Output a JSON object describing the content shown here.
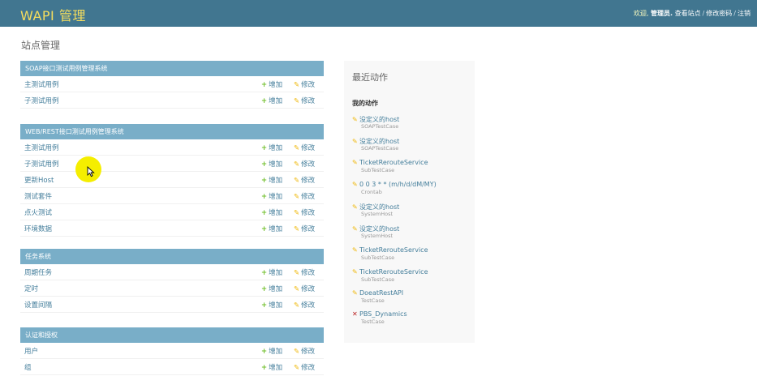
{
  "header": {
    "brand": "WAPI 管理",
    "welcome": "欢迎,",
    "username": "管理员.",
    "view_site": "查看站点",
    "change_password": "修改密码",
    "logout": "注销"
  },
  "page_title": "站点管理",
  "modules": [
    {
      "caption": "SOAP接口测试用例管理系统",
      "rows": [
        {
          "name": "主测试用例",
          "add": "增加",
          "change": "修改"
        },
        {
          "name": "子测试用例",
          "add": "增加",
          "change": "修改"
        }
      ]
    },
    {
      "caption": "WEB/REST接口测试用例管理系统",
      "rows": [
        {
          "name": "主测试用例",
          "add": "增加",
          "change": "修改"
        },
        {
          "name": "子测试用例",
          "add": "增加",
          "change": "修改"
        },
        {
          "name": "更新Host",
          "add": "增加",
          "change": "修改"
        },
        {
          "name": "测试套件",
          "add": "增加",
          "change": "修改"
        },
        {
          "name": "点火测试",
          "add": "增加",
          "change": "修改"
        },
        {
          "name": "环境数据",
          "add": "增加",
          "change": "修改"
        }
      ]
    },
    {
      "caption": "任务系统",
      "rows": [
        {
          "name": "周期任务",
          "add": "增加",
          "change": "修改"
        },
        {
          "name": "定时",
          "add": "增加",
          "change": "修改"
        },
        {
          "name": "设置间隔",
          "add": "增加",
          "change": "修改"
        }
      ]
    },
    {
      "caption": "认证和授权",
      "rows": [
        {
          "name": "用户",
          "add": "增加",
          "change": "修改"
        },
        {
          "name": "组",
          "add": "增加",
          "change": "修改"
        }
      ]
    }
  ],
  "sidebar": {
    "title": "最近动作",
    "subtitle": "我的动作",
    "actions": [
      {
        "icon": "pencil-icon",
        "object": "没定义的host",
        "type": "SOAPTestCase"
      },
      {
        "icon": "pencil-icon",
        "object": "没定义的host",
        "type": "SOAPTestCase"
      },
      {
        "icon": "pencil-icon",
        "object": "TicketRerouteService",
        "type": "SubTestCase"
      },
      {
        "icon": "pencil-icon",
        "object": "0 0 3 * * (m/h/d/dM/MY)",
        "type": "Crontab"
      },
      {
        "icon": "pencil-icon",
        "object": "没定义的host",
        "type": "SystemHost"
      },
      {
        "icon": "pencil-icon",
        "object": "没定义的host",
        "type": "SystemHost"
      },
      {
        "icon": "pencil-icon",
        "object": "TicketRerouteService",
        "type": "SubTestCase"
      },
      {
        "icon": "pencil-icon",
        "object": "TicketRerouteService",
        "type": "SubTestCase"
      },
      {
        "icon": "pencil-icon",
        "object": "DoeatRestAPI",
        "type": "TestCase"
      },
      {
        "icon": "delete-icon",
        "object": "PBS_Dynamics",
        "type": "TestCase"
      }
    ]
  },
  "colors": {
    "header_bg": "#417690",
    "brand": "#f5dd5d",
    "caption_bg": "#79aec8",
    "link": "#447e9b",
    "add_icon": "#70bf2b",
    "change_icon": "#efb80b",
    "delete_icon": "#ba2121",
    "cursor_highlight": "#f5ee00"
  }
}
